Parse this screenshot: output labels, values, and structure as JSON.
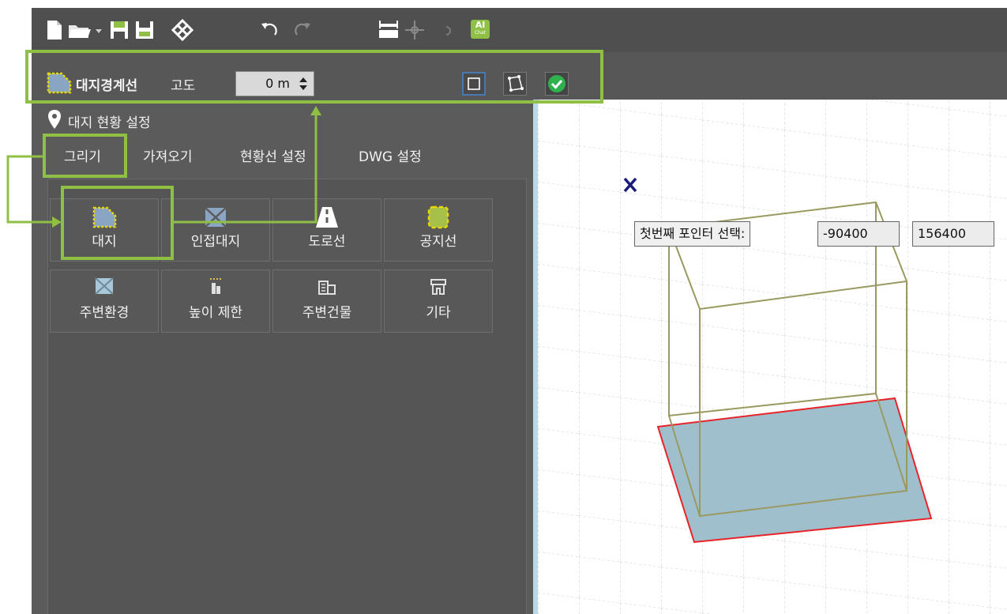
{
  "toolbar": {
    "icons": [
      "new-file-icon",
      "open-folder-icon",
      "dropdown-arrow-icon",
      "save-icon",
      "save-as-icon",
      "settings-mesh-icon",
      "undo-icon",
      "redo-icon",
      "measure-icon",
      "move-icon",
      "step-icon",
      "ai-chat-icon"
    ],
    "ai_label": "AI",
    "ai_sub": "Chat"
  },
  "subbar": {
    "title": "대지경계선",
    "elevation_label": "고도",
    "elevation_value": "0 m",
    "mode_icons": [
      "rectangle-mode-icon",
      "polygon-mode-icon",
      "confirm-icon"
    ]
  },
  "panel": {
    "header": "대지 현황 설정",
    "tabs": [
      "그리기",
      "가져오기",
      "현황선 설정",
      "DWG 설정"
    ],
    "grid_items": [
      {
        "label": "대지",
        "icon": "site-icon"
      },
      {
        "label": "인접대지",
        "icon": "adjacent-site-icon"
      },
      {
        "label": "도로선",
        "icon": "road-icon"
      },
      {
        "label": "공지선",
        "icon": "open-space-icon"
      },
      {
        "label": "주변환경",
        "icon": "environment-icon"
      },
      {
        "label": "높이 제한",
        "icon": "height-limit-icon"
      },
      {
        "label": "주변건물",
        "icon": "buildings-icon"
      },
      {
        "label": "기타",
        "icon": "other-icon"
      }
    ]
  },
  "viewport": {
    "prompt": "첫번째 포인터 선택:",
    "x_value": "-90400",
    "y_value": "156400"
  },
  "colors": {
    "highlight_green": "#8fc045",
    "site_fill": "#9fbfcc",
    "site_outline": "#e8242a",
    "wireframe": "#9a9a60",
    "cursor_x": "#1a1a7a"
  }
}
